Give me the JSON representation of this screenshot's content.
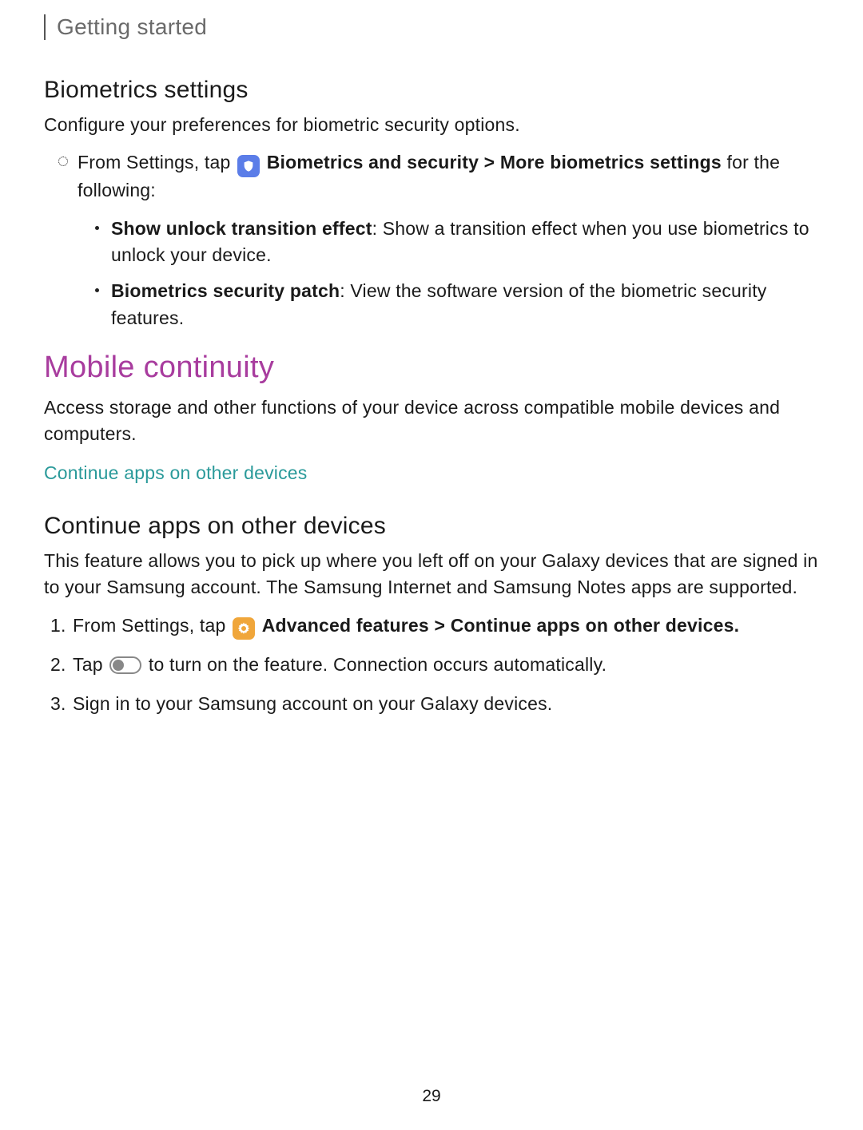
{
  "breadcrumb": "Getting started",
  "section1": {
    "heading": "Biometrics settings",
    "intro": "Configure your preferences for biometric security options.",
    "step_prefix": "From Settings, tap ",
    "step_bold": "Biometrics and security > More biometrics settings",
    "step_suffix": " for the following:",
    "sub1_bold": "Show unlock transition effect",
    "sub1_text": ": Show a transition effect when you use biometrics to unlock your device.",
    "sub2_bold": "Biometrics security patch",
    "sub2_text": ": View the software version of the biometric security features."
  },
  "section2": {
    "heading": "Mobile continuity",
    "intro": "Access storage and other functions of your device across compatible mobile devices and computers.",
    "link": "Continue apps on other devices"
  },
  "section3": {
    "heading": "Continue apps on other devices",
    "intro": "This feature allows you to pick up where you left off on your Galaxy devices that are signed in to your Samsung account. The Samsung Internet and Samsung Notes apps are supported.",
    "step1_prefix": "From Settings, tap ",
    "step1_bold": "Advanced features > Continue apps on other devices.",
    "step2_prefix": "Tap ",
    "step2_suffix": " to turn on the feature. Connection occurs automatically.",
    "step3": "Sign in to your Samsung account on your Galaxy devices."
  },
  "page_number": "29"
}
